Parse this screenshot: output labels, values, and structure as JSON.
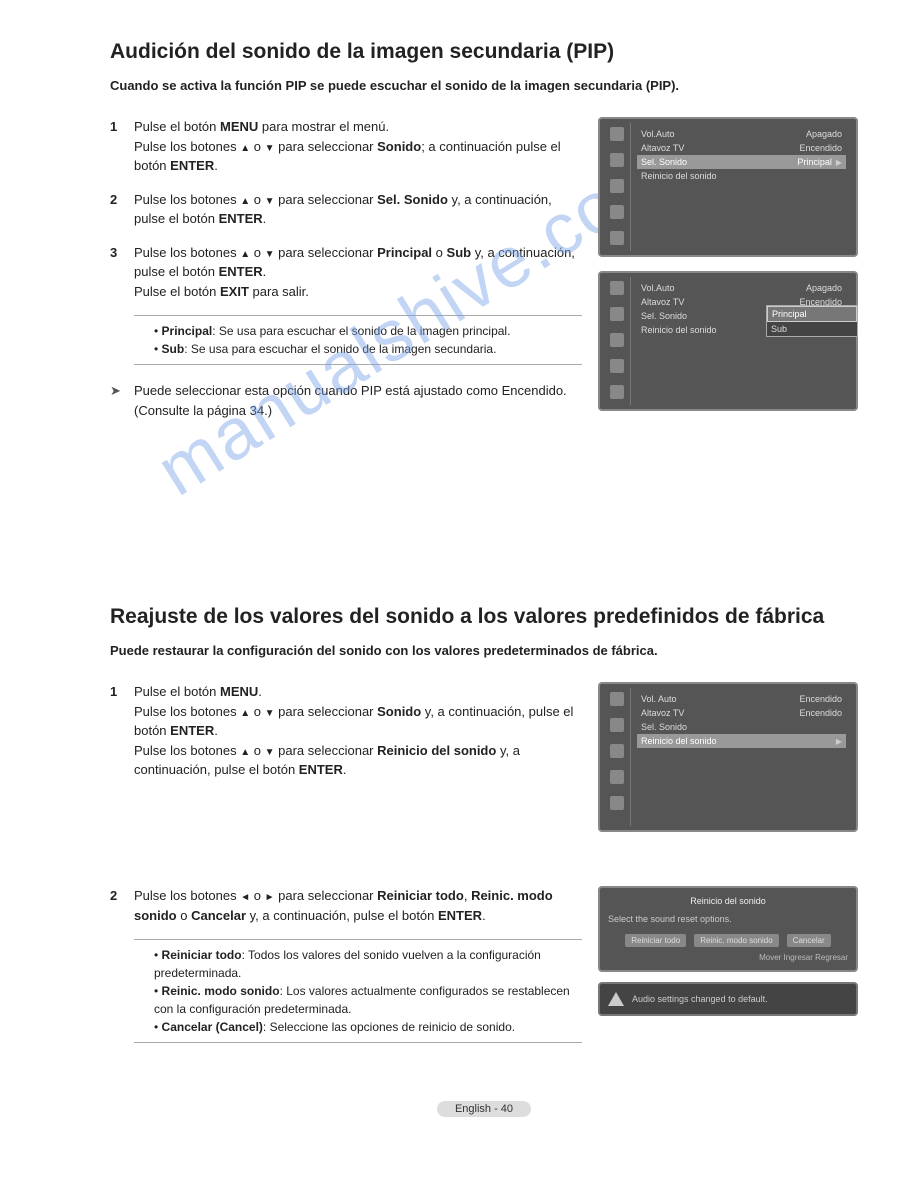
{
  "section1": {
    "title": "Audición del sonido de la imagen secundaria (PIP)",
    "subtitle": "Cuando se activa la función PIP se puede escuchar el sonido de la imagen secundaria (PIP).",
    "steps": [
      {
        "num": "1",
        "parts": [
          {
            "pre": "Pulse el botón ",
            "b": "MENU",
            "post": " para mostrar el menú."
          },
          {
            "pre": "Pulse los botones ",
            "arrows": "ud",
            "mid": " para seleccionar ",
            "b": "Sonido",
            "post": "; a continuación pulse el botón ",
            "b2": "ENTER",
            "post2": "."
          }
        ]
      },
      {
        "num": "2",
        "parts": [
          {
            "pre": "Pulse los botones ",
            "arrows": "ud",
            "mid": " para seleccionar ",
            "b": "Sel. Sonido",
            "post": " y, a continuación, pulse el botón ",
            "b2": "ENTER",
            "post2": "."
          }
        ]
      },
      {
        "num": "3",
        "parts": [
          {
            "pre": "Pulse los botones ",
            "arrows": "ud",
            "mid": " para seleccionar ",
            "b": "Principal",
            "post": " o ",
            "b2": "Sub",
            "post2": " y, a continuación, pulse el botón ",
            "b3": "ENTER",
            "post3": "."
          },
          {
            "pre": "Pulse el botón ",
            "b": "EXIT",
            "post": " para salir."
          }
        ]
      }
    ],
    "note": [
      {
        "b": "Principal",
        "text": ": Se usa para escuchar el sonido de la imagen principal."
      },
      {
        "b": "Sub",
        "text": ": Se usa para escuchar el sonido de la imagen secundaria."
      }
    ],
    "hint": "Puede seleccionar esta opción cuando PIP está ajustado como Encendido. (Consulte la página 34.)",
    "osd1": {
      "side": "Sonido",
      "rows": [
        {
          "l": "Vol.Auto",
          "r": "Apagado",
          "sel": false
        },
        {
          "l": "Altavoz TV",
          "r": "Encendido",
          "sel": false
        },
        {
          "l": "Sel. Sonido",
          "r": "Principal",
          "sel": true,
          "tri": true
        },
        {
          "l": "Reinicio del sonido",
          "r": "",
          "sel": false
        }
      ]
    },
    "osd2": {
      "side": "Sonido",
      "rows": [
        {
          "l": "Vol.Auto",
          "r": "Apagado",
          "sel": false
        },
        {
          "l": "Altavoz TV",
          "r": "Encendido",
          "sel": false
        },
        {
          "l": "Sel. Sonido",
          "r": "",
          "sel": false
        },
        {
          "l": "Reinicio del sonido",
          "r": "",
          "sel": false
        }
      ],
      "popup": [
        {
          "l": "Principal",
          "sel": true
        },
        {
          "l": "Sub",
          "sel": false
        }
      ]
    }
  },
  "section2": {
    "title": "Reajuste de los valores del sonido a los valores predefinidos de fábrica",
    "subtitle": "Puede restaurar la configuración del sonido con los valores predeterminados de fábrica.",
    "steps": [
      {
        "num": "1",
        "parts": [
          {
            "pre": "Pulse el botón ",
            "b": "MENU",
            "post": "."
          },
          {
            "pre": "Pulse los botones ",
            "arrows": "ud",
            "mid": " para seleccionar ",
            "b": "Sonido",
            "post": " y, a continuación, pulse el botón ",
            "b2": "ENTER",
            "post2": "."
          },
          {
            "pre": "Pulse los botones ",
            "arrows": "ud",
            "mid": " para seleccionar ",
            "b": "Reinicio del sonido",
            "post": " y, a continuación, pulse el botón ",
            "b2": "ENTER",
            "post2": "."
          }
        ]
      },
      {
        "num": "2",
        "parts": [
          {
            "pre": "Pulse los botones ",
            "arrows": "lr",
            "mid": " para seleccionar ",
            "b": "Reiniciar todo",
            "post": ", ",
            "b2": "Reinic. modo sonido",
            "post2": " o ",
            "b3": "Cancelar",
            "post3": " y, a continuación, pulse el botón ",
            "b4": "ENTER",
            "post4": "."
          }
        ]
      }
    ],
    "note": [
      {
        "b": "Reiniciar todo",
        "text": ": Todos los valores del sonido vuelven a la configuración predeterminada."
      },
      {
        "b": "Reinic. modo sonido",
        "text": ": Los valores actualmente configurados se restablecen con la configuración predeterminada."
      },
      {
        "b": "Cancelar (Cancel)",
        "text": ": Seleccione las opciones de reinicio de sonido."
      }
    ],
    "osd1": {
      "side": "Sonido",
      "rows": [
        {
          "l": "Vol. Auto",
          "r": "Encendido",
          "sel": false
        },
        {
          "l": "Altavoz TV",
          "r": "Encendido",
          "sel": false
        },
        {
          "l": "Sel. Sonido",
          "r": "",
          "sel": false
        },
        {
          "l": "Reinicio del sonido",
          "r": "",
          "sel": true,
          "tri": true
        }
      ]
    },
    "dialog": {
      "title": "Reinicio del sonido",
      "text": "Select the sound reset options.",
      "buttons": [
        "Reiniciar todo",
        "Reinic. modo sonido",
        "Cancelar"
      ],
      "footer": "Mover   Ingresar   Regresar"
    },
    "alert": "Audio settings changed to default."
  },
  "watermark": "manualshive.com",
  "footer": "English - 40"
}
